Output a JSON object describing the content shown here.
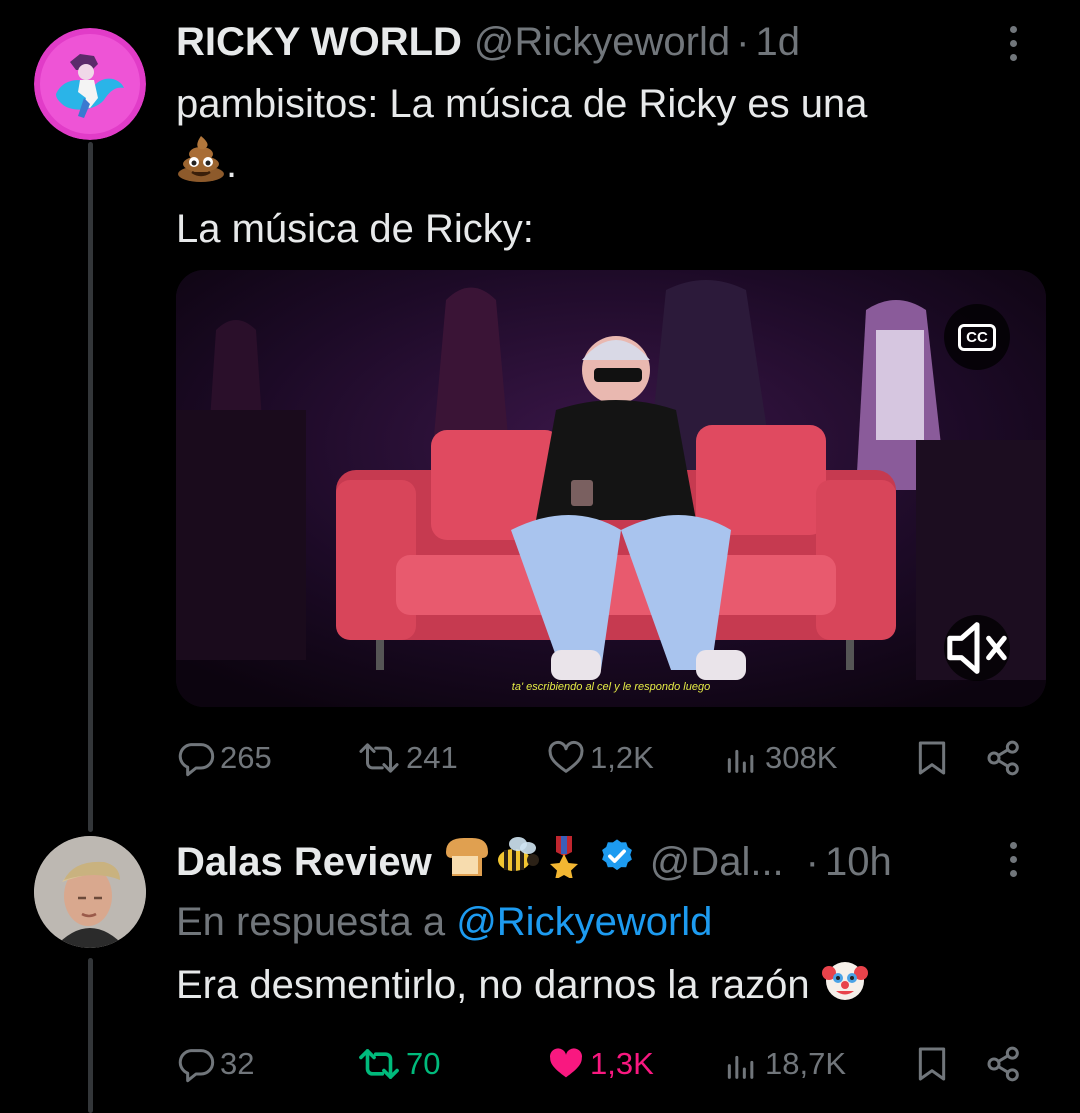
{
  "tweet1": {
    "name": "RICKY WORLD",
    "handle": "@Rickyeworld",
    "time": "1d",
    "text_line1": "pambisitos: La música de Ricky es una",
    "text_line2_suffix": ".",
    "text_line3": "La música de Ricky:",
    "media": {
      "subtitle": "ta' escribiendo al cel y le respondo luego",
      "cc_label": "CC",
      "cc_icon": "closed-captions-icon",
      "mute_icon": "volume-muted-icon"
    },
    "stats": {
      "replies": "265",
      "retweets": "241",
      "likes": "1,2K",
      "views": "308K"
    }
  },
  "tweet2": {
    "name": "Dalas Review",
    "badges": [
      "bread-emoji",
      "bee-emoji",
      "medal-emoji",
      "verified-badge"
    ],
    "handle": "@Dal...",
    "time": "10h",
    "reply_prefix": "En respuesta a",
    "reply_to": "@Rickyeworld",
    "text": "Era desmentirlo, no darnos la razón",
    "stats": {
      "replies": "32",
      "retweets": "70",
      "likes": "1,3K",
      "views": "18,7K"
    },
    "retweeted": true,
    "liked": true
  },
  "colors": {
    "background": "#000000",
    "text": "#e7e9ea",
    "muted": "#71767b",
    "link": "#1d9bf0",
    "retweet_green": "#00ba7c",
    "like_pink": "#f91880",
    "verified_blue": "#1d9bf0"
  }
}
